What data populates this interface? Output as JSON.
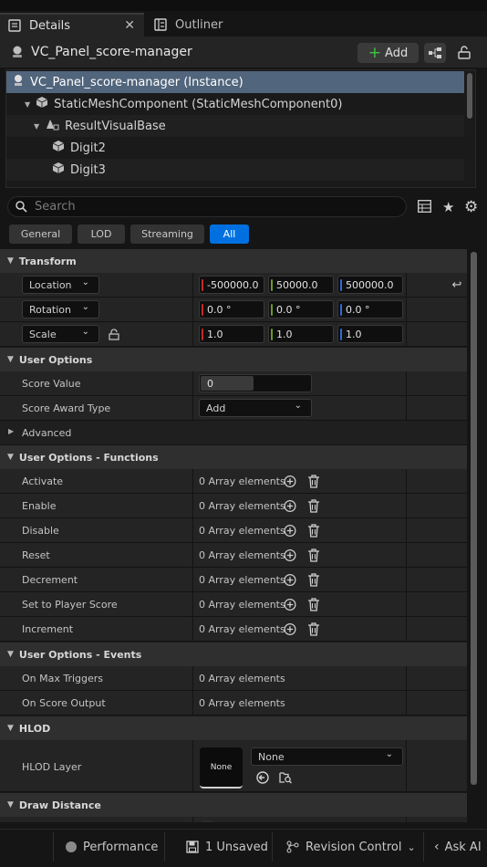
{
  "tabs": {
    "details": "Details",
    "outliner": "Outliner"
  },
  "header": {
    "title": "VC_Panel_score-manager",
    "add_label": "Add"
  },
  "tree": [
    {
      "label": "VC_Panel_score-manager (Instance)",
      "depth": 0
    },
    {
      "label": "StaticMeshComponent (StaticMeshComponent0)",
      "depth": 1
    },
    {
      "label": "ResultVisualBase",
      "depth": 2
    },
    {
      "label": "Digit2",
      "depth": 3
    },
    {
      "label": "Digit3",
      "depth": 3
    }
  ],
  "search": {
    "placeholder": "Search"
  },
  "filters": [
    "General",
    "LOD",
    "Streaming",
    "All"
  ],
  "sections": {
    "transform": "Transform",
    "user_options": "User Options",
    "advanced": "Advanced",
    "functions": "User Options - Functions",
    "events": "User Options - Events",
    "hlod": "HLOD",
    "draw_distance": "Draw Distance"
  },
  "transform": {
    "location": {
      "label": "Location",
      "x": "-500000.0",
      "y": "50000.0",
      "z": "500000.0"
    },
    "rotation": {
      "label": "Rotation",
      "x": "0.0 °",
      "y": "0.0 °",
      "z": "0.0 °"
    },
    "scale": {
      "label": "Scale",
      "x": "1.0",
      "y": "1.0",
      "z": "1.0"
    }
  },
  "user_options": {
    "score_value_label": "Score Value",
    "score_value": "0",
    "award_type_label": "Score Award Type",
    "award_type": "Add"
  },
  "functions": [
    {
      "label": "Activate",
      "value": "0 Array elements"
    },
    {
      "label": "Enable",
      "value": "0 Array elements"
    },
    {
      "label": "Disable",
      "value": "0 Array elements"
    },
    {
      "label": "Reset",
      "value": "0 Array elements"
    },
    {
      "label": "Decrement",
      "value": "0 Array elements"
    },
    {
      "label": "Set to Player Score",
      "value": "0 Array elements"
    },
    {
      "label": "Increment",
      "value": "0 Array elements"
    }
  ],
  "events": [
    {
      "label": "On Max Triggers",
      "value": "0 Array elements"
    },
    {
      "label": "On Score Output",
      "value": "0 Array elements"
    }
  ],
  "hlod": {
    "layer_label": "HLOD Layer",
    "thumb": "None",
    "value": "None"
  },
  "status": {
    "performance": "Performance",
    "unsaved": "1 Unsaved",
    "revision": "Revision Control",
    "ask_ai": "Ask AI"
  },
  "colors": {
    "x_axis": "#c62828",
    "y_axis": "#6a9a22",
    "z_axis": "#2f6bd4",
    "accent": "#0070e0"
  }
}
